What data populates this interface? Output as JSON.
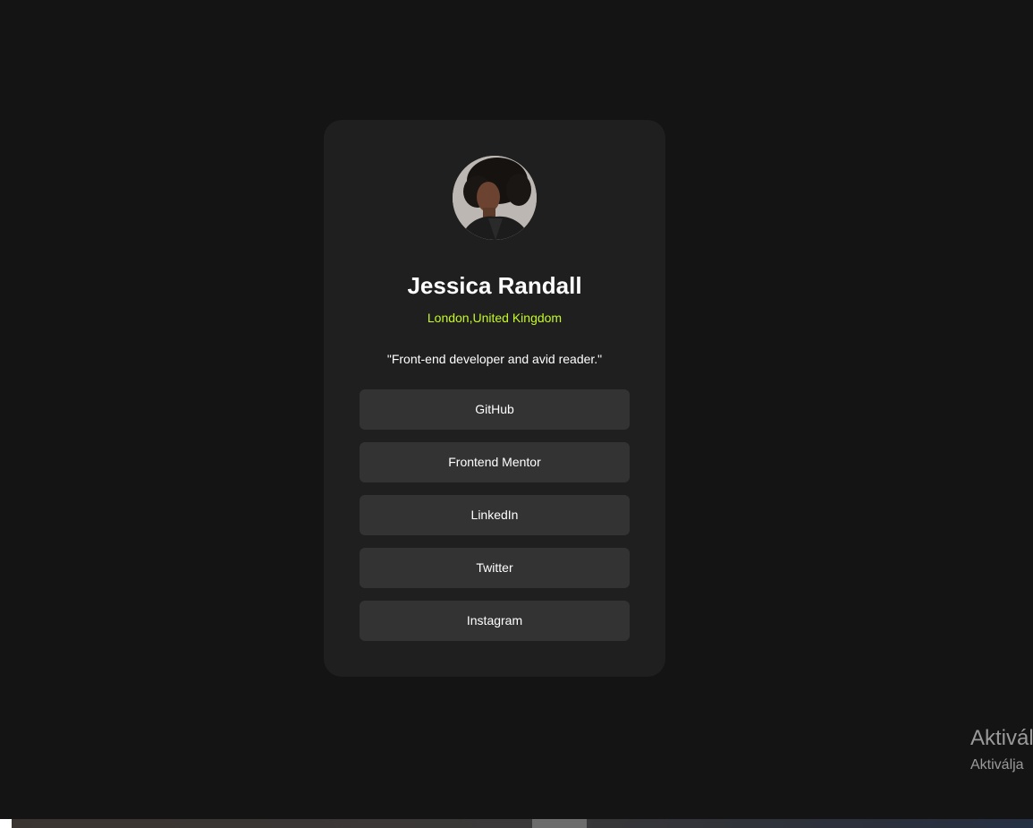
{
  "profile": {
    "name": "Jessica Randall",
    "location": "London,United Kingdom",
    "bio": "\"Front-end developer and avid reader.\""
  },
  "links": [
    {
      "label": "GitHub"
    },
    {
      "label": "Frontend Mentor"
    },
    {
      "label": "LinkedIn"
    },
    {
      "label": "Twitter"
    },
    {
      "label": "Instagram"
    }
  ],
  "watermark": {
    "title": "Aktivál",
    "subtitle": "Aktiválja"
  },
  "colors": {
    "background": "#141414",
    "card": "#1f1f1f",
    "button": "#333333",
    "accent": "#c4f82a",
    "text": "#ffffff"
  }
}
